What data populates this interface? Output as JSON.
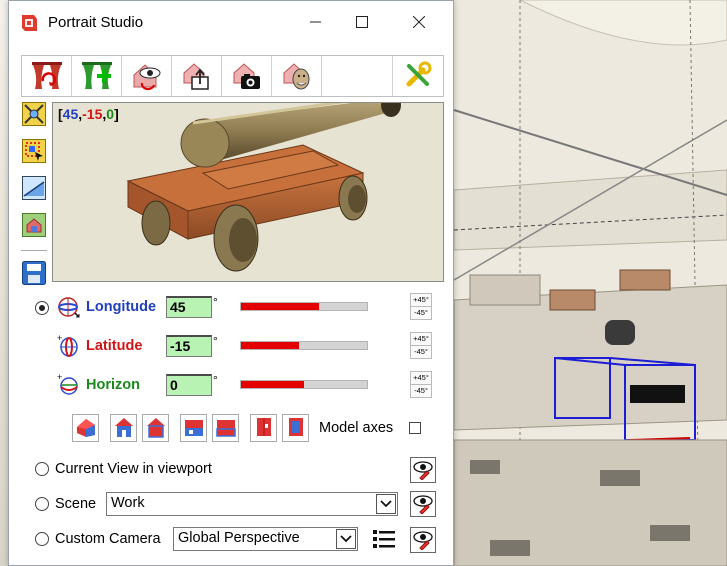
{
  "window": {
    "title": "Portrait Studio"
  },
  "preview": {
    "coord_open": "[",
    "coord_x": "45",
    "coord_sep1": ",",
    "coord_y": "-15",
    "coord_sep2": ",",
    "coord_z": "0",
    "coord_close": "]"
  },
  "params": [
    {
      "label": "Longitude",
      "value": "45",
      "fraction": 0.62,
      "color": "#1f3fbf",
      "plus": "+45°",
      "minus": "-45°"
    },
    {
      "label": "Latitude",
      "value": "-15",
      "fraction": 0.46,
      "color": "#d21414",
      "plus": "+45°",
      "minus": "-45°"
    },
    {
      "label": "Horizon",
      "value": "0",
      "fraction": 0.5,
      "color": "#1a8a1a",
      "plus": "+45°",
      "minus": "-45°"
    }
  ],
  "degree_symbol": "°",
  "model_axes_label": "Model axes",
  "current_view_label": "Current View in viewport",
  "scene": {
    "label": "Scene",
    "value": "Work"
  },
  "custom_camera": {
    "label": "Custom Camera",
    "value": "Global Perspective"
  },
  "colors": {
    "accent_red": "#e50000",
    "field_green": "#b9f3b3"
  }
}
